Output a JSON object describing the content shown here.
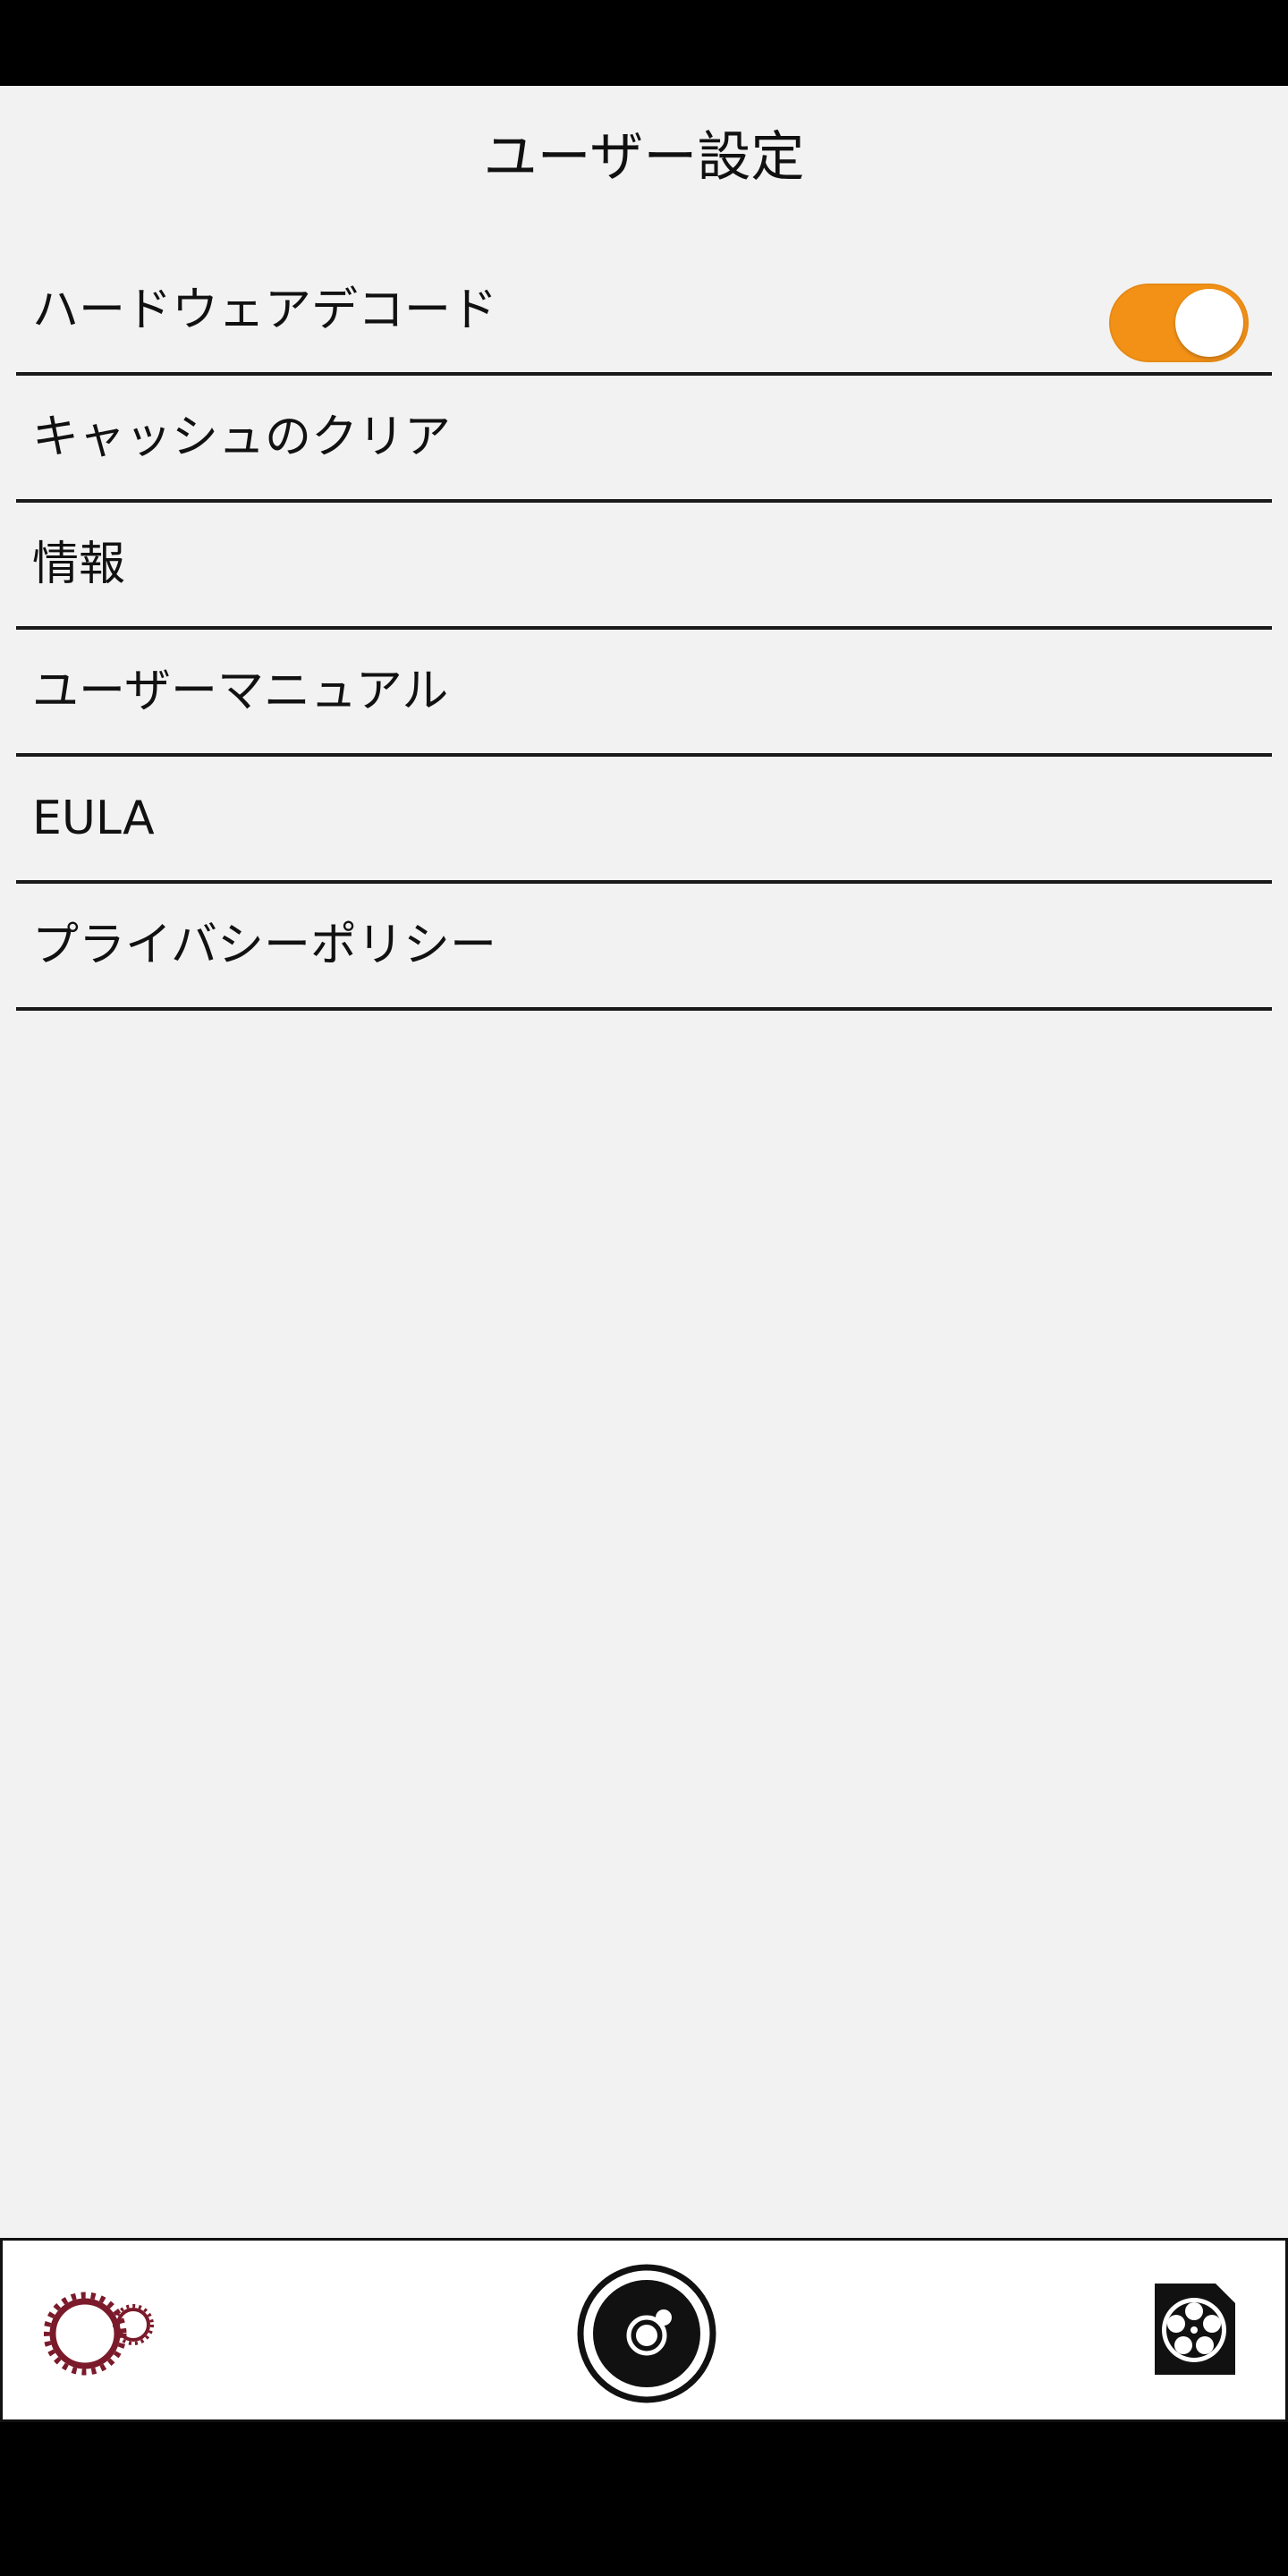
{
  "header": {
    "title": "ユーザー設定"
  },
  "settings": {
    "items": [
      {
        "label": "ハードウェアデコード",
        "toggle": true,
        "toggle_on": true
      },
      {
        "label": "キャッシュのクリア"
      },
      {
        "label": "情報"
      },
      {
        "label": "ユーザーマニュアル"
      },
      {
        "label": "EULA"
      },
      {
        "label": "プライバシーポリシー"
      }
    ]
  },
  "colors": {
    "background": "#f2f2f2",
    "toggle_on": "#f39117",
    "settings_icon": "#7a1a2a",
    "divider": "#1a1a1a"
  },
  "tab_bar": {
    "items": [
      {
        "icon": "gears-icon",
        "role": "settings"
      },
      {
        "icon": "camera-shutter-icon",
        "role": "capture"
      },
      {
        "icon": "film-reel-icon",
        "role": "media"
      }
    ]
  }
}
